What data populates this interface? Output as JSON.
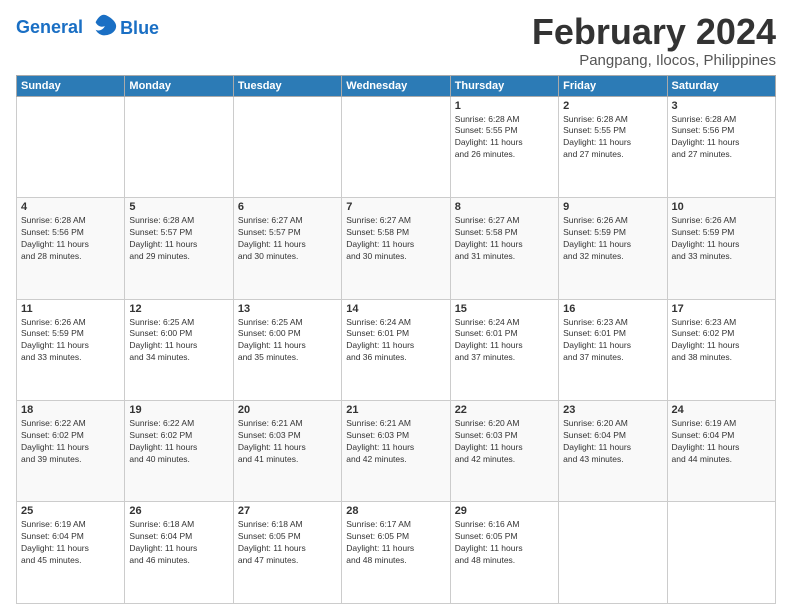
{
  "logo": {
    "line1": "General",
    "line2": "Blue"
  },
  "title": "February 2024",
  "subtitle": "Pangpang, Ilocos, Philippines",
  "headers": [
    "Sunday",
    "Monday",
    "Tuesday",
    "Wednesday",
    "Thursday",
    "Friday",
    "Saturday"
  ],
  "weeks": [
    [
      {
        "day": "",
        "info": ""
      },
      {
        "day": "",
        "info": ""
      },
      {
        "day": "",
        "info": ""
      },
      {
        "day": "",
        "info": ""
      },
      {
        "day": "1",
        "info": "Sunrise: 6:28 AM\nSunset: 5:55 PM\nDaylight: 11 hours\nand 26 minutes."
      },
      {
        "day": "2",
        "info": "Sunrise: 6:28 AM\nSunset: 5:55 PM\nDaylight: 11 hours\nand 27 minutes."
      },
      {
        "day": "3",
        "info": "Sunrise: 6:28 AM\nSunset: 5:56 PM\nDaylight: 11 hours\nand 27 minutes."
      }
    ],
    [
      {
        "day": "4",
        "info": "Sunrise: 6:28 AM\nSunset: 5:56 PM\nDaylight: 11 hours\nand 28 minutes."
      },
      {
        "day": "5",
        "info": "Sunrise: 6:28 AM\nSunset: 5:57 PM\nDaylight: 11 hours\nand 29 minutes."
      },
      {
        "day": "6",
        "info": "Sunrise: 6:27 AM\nSunset: 5:57 PM\nDaylight: 11 hours\nand 30 minutes."
      },
      {
        "day": "7",
        "info": "Sunrise: 6:27 AM\nSunset: 5:58 PM\nDaylight: 11 hours\nand 30 minutes."
      },
      {
        "day": "8",
        "info": "Sunrise: 6:27 AM\nSunset: 5:58 PM\nDaylight: 11 hours\nand 31 minutes."
      },
      {
        "day": "9",
        "info": "Sunrise: 6:26 AM\nSunset: 5:59 PM\nDaylight: 11 hours\nand 32 minutes."
      },
      {
        "day": "10",
        "info": "Sunrise: 6:26 AM\nSunset: 5:59 PM\nDaylight: 11 hours\nand 33 minutes."
      }
    ],
    [
      {
        "day": "11",
        "info": "Sunrise: 6:26 AM\nSunset: 5:59 PM\nDaylight: 11 hours\nand 33 minutes."
      },
      {
        "day": "12",
        "info": "Sunrise: 6:25 AM\nSunset: 6:00 PM\nDaylight: 11 hours\nand 34 minutes."
      },
      {
        "day": "13",
        "info": "Sunrise: 6:25 AM\nSunset: 6:00 PM\nDaylight: 11 hours\nand 35 minutes."
      },
      {
        "day": "14",
        "info": "Sunrise: 6:24 AM\nSunset: 6:01 PM\nDaylight: 11 hours\nand 36 minutes."
      },
      {
        "day": "15",
        "info": "Sunrise: 6:24 AM\nSunset: 6:01 PM\nDaylight: 11 hours\nand 37 minutes."
      },
      {
        "day": "16",
        "info": "Sunrise: 6:23 AM\nSunset: 6:01 PM\nDaylight: 11 hours\nand 37 minutes."
      },
      {
        "day": "17",
        "info": "Sunrise: 6:23 AM\nSunset: 6:02 PM\nDaylight: 11 hours\nand 38 minutes."
      }
    ],
    [
      {
        "day": "18",
        "info": "Sunrise: 6:22 AM\nSunset: 6:02 PM\nDaylight: 11 hours\nand 39 minutes."
      },
      {
        "day": "19",
        "info": "Sunrise: 6:22 AM\nSunset: 6:02 PM\nDaylight: 11 hours\nand 40 minutes."
      },
      {
        "day": "20",
        "info": "Sunrise: 6:21 AM\nSunset: 6:03 PM\nDaylight: 11 hours\nand 41 minutes."
      },
      {
        "day": "21",
        "info": "Sunrise: 6:21 AM\nSunset: 6:03 PM\nDaylight: 11 hours\nand 42 minutes."
      },
      {
        "day": "22",
        "info": "Sunrise: 6:20 AM\nSunset: 6:03 PM\nDaylight: 11 hours\nand 42 minutes."
      },
      {
        "day": "23",
        "info": "Sunrise: 6:20 AM\nSunset: 6:04 PM\nDaylight: 11 hours\nand 43 minutes."
      },
      {
        "day": "24",
        "info": "Sunrise: 6:19 AM\nSunset: 6:04 PM\nDaylight: 11 hours\nand 44 minutes."
      }
    ],
    [
      {
        "day": "25",
        "info": "Sunrise: 6:19 AM\nSunset: 6:04 PM\nDaylight: 11 hours\nand 45 minutes."
      },
      {
        "day": "26",
        "info": "Sunrise: 6:18 AM\nSunset: 6:04 PM\nDaylight: 11 hours\nand 46 minutes."
      },
      {
        "day": "27",
        "info": "Sunrise: 6:18 AM\nSunset: 6:05 PM\nDaylight: 11 hours\nand 47 minutes."
      },
      {
        "day": "28",
        "info": "Sunrise: 6:17 AM\nSunset: 6:05 PM\nDaylight: 11 hours\nand 48 minutes."
      },
      {
        "day": "29",
        "info": "Sunrise: 6:16 AM\nSunset: 6:05 PM\nDaylight: 11 hours\nand 48 minutes."
      },
      {
        "day": "",
        "info": ""
      },
      {
        "day": "",
        "info": ""
      }
    ]
  ]
}
